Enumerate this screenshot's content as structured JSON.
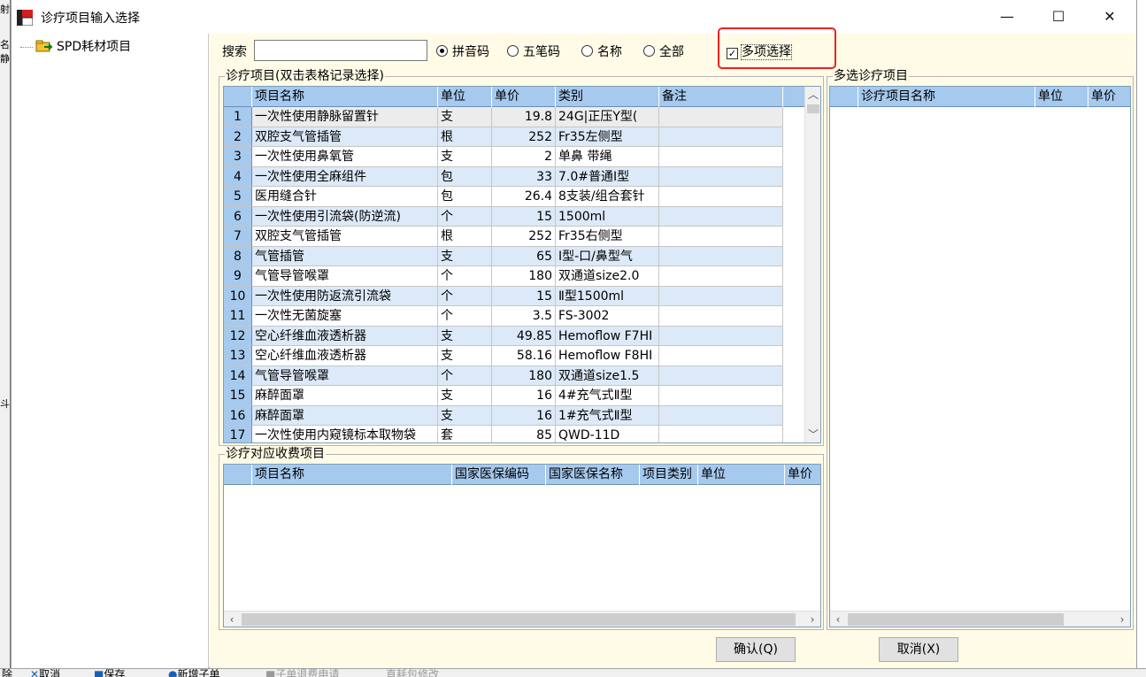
{
  "window": {
    "title": "诊疗项目输入选择",
    "controls": {
      "minimize": "—",
      "maximize": "☐",
      "close": "✕"
    }
  },
  "background_fragments": {
    "left": [
      "射",
      "名",
      "静",
      "斗"
    ],
    "bottom": [
      "除",
      "取消",
      "保存",
      "新增子单",
      "子单退费申请",
      "直耗包修改"
    ]
  },
  "tree": {
    "items": [
      {
        "label": "SPD耗材项目"
      }
    ]
  },
  "search": {
    "label": "搜索",
    "value": "",
    "placeholder": "",
    "options": [
      {
        "label": "拼音码",
        "selected": true
      },
      {
        "label": "五笔码",
        "selected": false
      },
      {
        "label": "名称",
        "selected": false
      },
      {
        "label": "全部",
        "selected": false
      }
    ],
    "multi_select": {
      "label": "多项选择",
      "checked": true,
      "check_mark": "✓"
    }
  },
  "items_panel": {
    "title": "诊疗项目(双击表格记录选择)",
    "columns": [
      "",
      "项目名称",
      "单位",
      "单价",
      "类别",
      "备注"
    ],
    "rows": [
      {
        "no": "1",
        "name": "一次性使用静脉留置针",
        "unit": "支",
        "price": "19.8",
        "category": "24G|正压Y型(",
        "note": ""
      },
      {
        "no": "2",
        "name": "双腔支气管插管",
        "unit": "根",
        "price": "252",
        "category": "Fr35左侧型",
        "note": ""
      },
      {
        "no": "3",
        "name": "一次性使用鼻氧管",
        "unit": "支",
        "price": "2",
        "category": "单鼻 带绳",
        "note": ""
      },
      {
        "no": "4",
        "name": "一次性使用全麻组件",
        "unit": "包",
        "price": "33",
        "category": "7.0#普通Ⅰ型",
        "note": ""
      },
      {
        "no": "5",
        "name": "医用缝合针",
        "unit": "包",
        "price": "26.4",
        "category": "8支装/组合套针",
        "note": ""
      },
      {
        "no": "6",
        "name": "一次性使用引流袋(防逆流)",
        "unit": "个",
        "price": "15",
        "category": "1500ml",
        "note": ""
      },
      {
        "no": "7",
        "name": "双腔支气管插管",
        "unit": "根",
        "price": "252",
        "category": "Fr35右侧型",
        "note": ""
      },
      {
        "no": "8",
        "name": "气管插管",
        "unit": "支",
        "price": "65",
        "category": "Ⅰ型-口/鼻型气",
        "note": ""
      },
      {
        "no": "9",
        "name": "气管导管喉罩",
        "unit": "个",
        "price": "180",
        "category": "双通道size2.0",
        "note": ""
      },
      {
        "no": "10",
        "name": "一次性使用防返流引流袋",
        "unit": "个",
        "price": "15",
        "category": "Ⅱ型1500ml",
        "note": ""
      },
      {
        "no": "11",
        "name": "一次性无菌旋塞",
        "unit": "个",
        "price": "3.5",
        "category": "FS-3002",
        "note": ""
      },
      {
        "no": "12",
        "name": "空心纤维血液透析器",
        "unit": "支",
        "price": "49.85",
        "category": "Hemoflow F7HI",
        "note": ""
      },
      {
        "no": "13",
        "name": "空心纤维血液透析器",
        "unit": "支",
        "price": "58.16",
        "category": "Hemoflow F8HI",
        "note": ""
      },
      {
        "no": "14",
        "name": "气管导管喉罩",
        "unit": "个",
        "price": "180",
        "category": "双通道size1.5",
        "note": ""
      },
      {
        "no": "15",
        "name": "麻醉面罩",
        "unit": "支",
        "price": "16",
        "category": "4#充气式Ⅱ型",
        "note": ""
      },
      {
        "no": "16",
        "name": "麻醉面罩",
        "unit": "支",
        "price": "16",
        "category": "1#充气式Ⅱ型",
        "note": ""
      },
      {
        "no": "17",
        "name": "一次性使用内窥镜标本取物袋",
        "unit": "套",
        "price": "85",
        "category": "QWD-11D",
        "note": ""
      }
    ]
  },
  "charge_panel": {
    "title": "诊疗对应收费项目",
    "columns": [
      "",
      "项目名称",
      "国家医保编码",
      "国家医保名称",
      "项目类别",
      "单位",
      "单价"
    ]
  },
  "multi_panel": {
    "title": "多选诊疗项目",
    "columns": [
      "",
      "诊疗项目名称",
      "单位",
      "单价"
    ]
  },
  "scroll_arrows": {
    "up": "︿",
    "down": "﹀",
    "left": "‹",
    "right": "›"
  },
  "buttons": {
    "confirm": "确认(Q)",
    "cancel": "取消(X)"
  }
}
